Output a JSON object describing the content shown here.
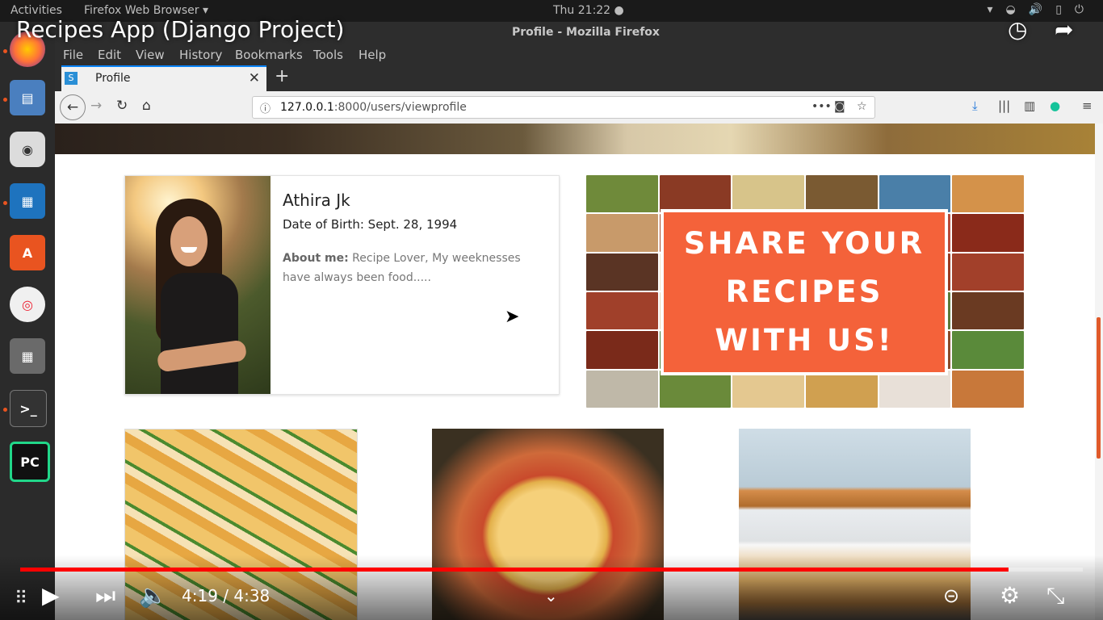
{
  "system": {
    "activities": "Activities",
    "app_name": "Firefox Web Browser ▾",
    "clock": "Thu 21:22 ●"
  },
  "window": {
    "title": "Profile - Mozilla Firefox"
  },
  "menu": [
    "File",
    "Edit",
    "View",
    "History",
    "Bookmarks",
    "Tools",
    "Help"
  ],
  "tab": {
    "label": "Profile",
    "favicon": "S",
    "close": "✕",
    "new": "+"
  },
  "url": {
    "host": "127.0.0.1",
    "path": ":8000/users/viewprofile"
  },
  "profile": {
    "name": "Athira Jk",
    "dob": "Date of Birth: Sept. 28, 1994",
    "about_label": "About me:",
    "about_text": " Recipe Lover, My weeknesses have always been food....."
  },
  "promo": {
    "line1": "SHARE YOUR",
    "line2": "RECIPES",
    "line3": "WITH US!"
  },
  "video": {
    "title": "Recipes App (Django Project)",
    "time": "4:19 / 4:38",
    "progress": 0.93
  }
}
